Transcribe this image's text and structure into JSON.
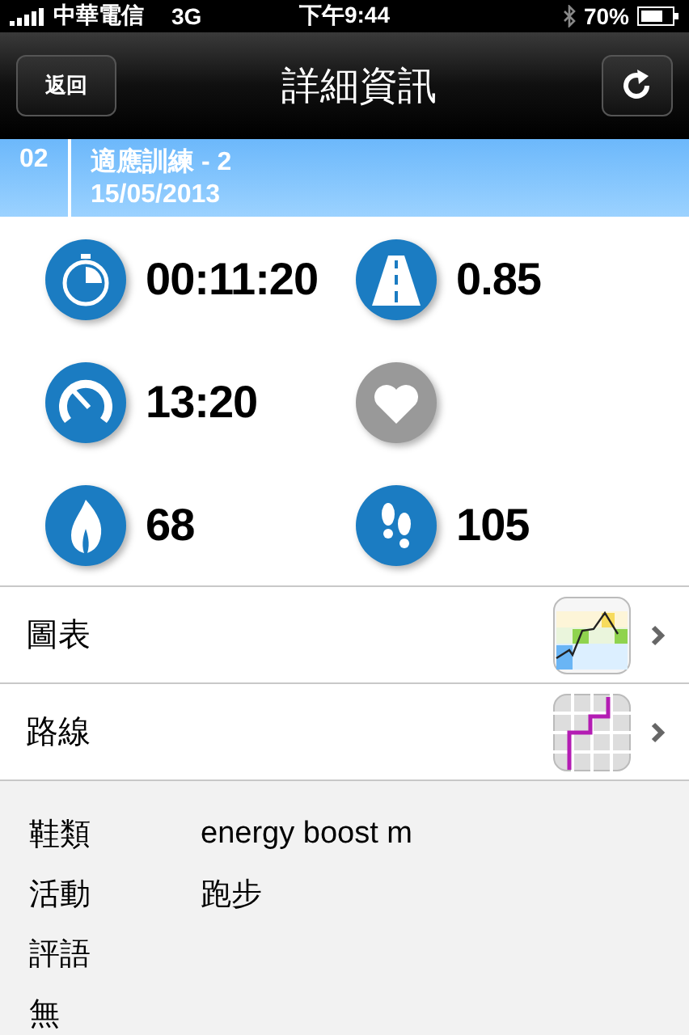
{
  "status_bar": {
    "carrier": "中華電信",
    "network": "3G",
    "time": "下午9:44",
    "battery": "70%"
  },
  "nav": {
    "back": "返回",
    "title": "詳細資訊"
  },
  "workout": {
    "number": "02",
    "name": "適應訓練 - 2",
    "date": "15/05/2013"
  },
  "stats": [
    {
      "kind": "stopwatch",
      "value": "00:11:20",
      "disabled": false
    },
    {
      "kind": "road",
      "value": "0.85",
      "disabled": false
    },
    {
      "kind": "gauge",
      "value": "13:20",
      "disabled": false
    },
    {
      "kind": "heart",
      "disabled": true
    },
    {
      "kind": "flame",
      "value": "68",
      "disabled": false
    },
    {
      "kind": "footprints",
      "value": "105",
      "disabled": false
    }
  ],
  "links": [
    {
      "label": "圖表",
      "kind": "chart"
    },
    {
      "label": "路線",
      "kind": "route"
    }
  ],
  "details": [
    {
      "label": "鞋類",
      "value": "energy boost m"
    },
    {
      "label": "活動",
      "value": "跑步"
    },
    {
      "label": "評語"
    }
  ],
  "comment": "無"
}
